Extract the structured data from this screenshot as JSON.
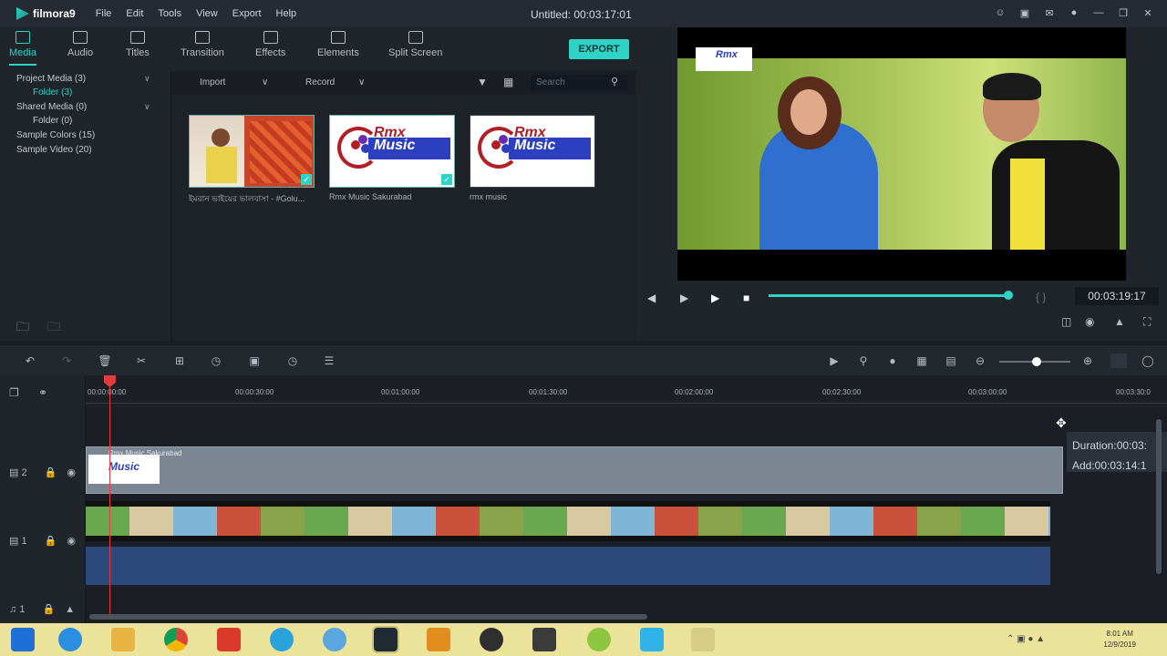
{
  "app": {
    "logo": "filmora9",
    "title": "Untitled: 00:03:17:01"
  },
  "menu": [
    "File",
    "Edit",
    "Tools",
    "View",
    "Export",
    "Help"
  ],
  "tabs": [
    {
      "label": "Media",
      "icon": "folder-icon"
    },
    {
      "label": "Audio",
      "icon": "music-note-icon"
    },
    {
      "label": "Titles",
      "icon": "text-icon"
    },
    {
      "label": "Transition",
      "icon": "transition-icon"
    },
    {
      "label": "Effects",
      "icon": "effects-icon"
    },
    {
      "label": "Elements",
      "icon": "image-icon"
    },
    {
      "label": "Split Screen",
      "icon": "split-screen-icon"
    }
  ],
  "export_label": "EXPORT",
  "library": {
    "items": [
      {
        "label": "Project Media (3)"
      },
      {
        "label": "Folder (3)"
      },
      {
        "label": "Shared Media (0)"
      },
      {
        "label": "Folder (0)"
      },
      {
        "label": "Sample Colors (15)"
      },
      {
        "label": "Sample Video (20)"
      }
    ]
  },
  "media_toolbar": {
    "import": "Import",
    "record": "Record",
    "search_placeholder": "Search"
  },
  "thumbnails": [
    {
      "label": "ইমরান ভাইয়ের ভালবাসা - #Golu..."
    },
    {
      "label": "Rmx Music Sakurabad"
    },
    {
      "label": "rmx music"
    }
  ],
  "logo_text": {
    "line1": "Rmx",
    "line2": "Music"
  },
  "preview": {
    "timecode": "00:03:19:17",
    "progress": 0.99
  },
  "ruler": [
    "00:00:00:00",
    "00:00:30:00",
    "00:01:00:00",
    "00:01:30:00",
    "00:02:00:00",
    "00:02:30:00",
    "00:03:00:00",
    "00:03:30:0"
  ],
  "tracks": {
    "track2_label": "2",
    "track2_clip": "Rmx Music Sakurabad",
    "track1_label": "1",
    "audio_label": "1"
  },
  "duration_tip": {
    "duration": "Duration:00:03:",
    "add": "Add:00:03:14:1"
  },
  "clock": {
    "time": "8:01 AM",
    "date": "12/9/2019"
  },
  "colors": {
    "accent": "#2ed3c6",
    "playhead": "#e63b3b",
    "audio_track": "#2e4a7c",
    "taskbar": "#ece39a"
  }
}
